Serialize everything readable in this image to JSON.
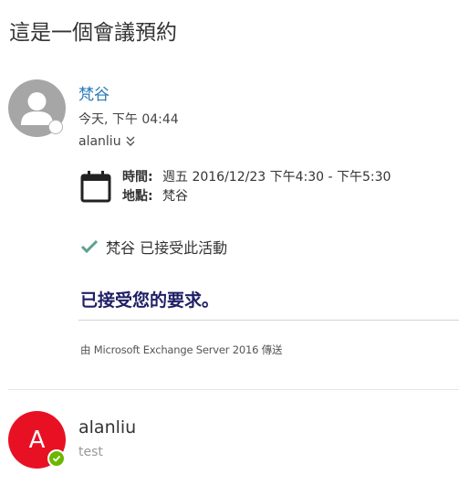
{
  "subject": "這是一個會議預約",
  "message1": {
    "sender": "梵谷",
    "sent_time": "今天, 下午 04:44",
    "recipients": "alanliu",
    "avatar_icon": "person-silhouette-icon",
    "presence": "presence-unknown",
    "meeting": {
      "when_label": "時間:",
      "when_value": "週五 2016/12/23 下午4:30 - 下午5:30",
      "where_label": "地點:",
      "where_value": "梵谷"
    },
    "response_status": "梵谷 已接受此活動",
    "body": "已接受您的要求。",
    "sent_via": "由 Microsoft Exchange Server 2016 傳送"
  },
  "message2": {
    "avatar_initial": "A",
    "avatar_color": "#e81123",
    "presence": "presence-available",
    "sender": "alanliu",
    "preview": "test"
  },
  "colors": {
    "link": "#2b7bb9",
    "accepted_check": "#5ea08e",
    "online": "#6bb700"
  }
}
